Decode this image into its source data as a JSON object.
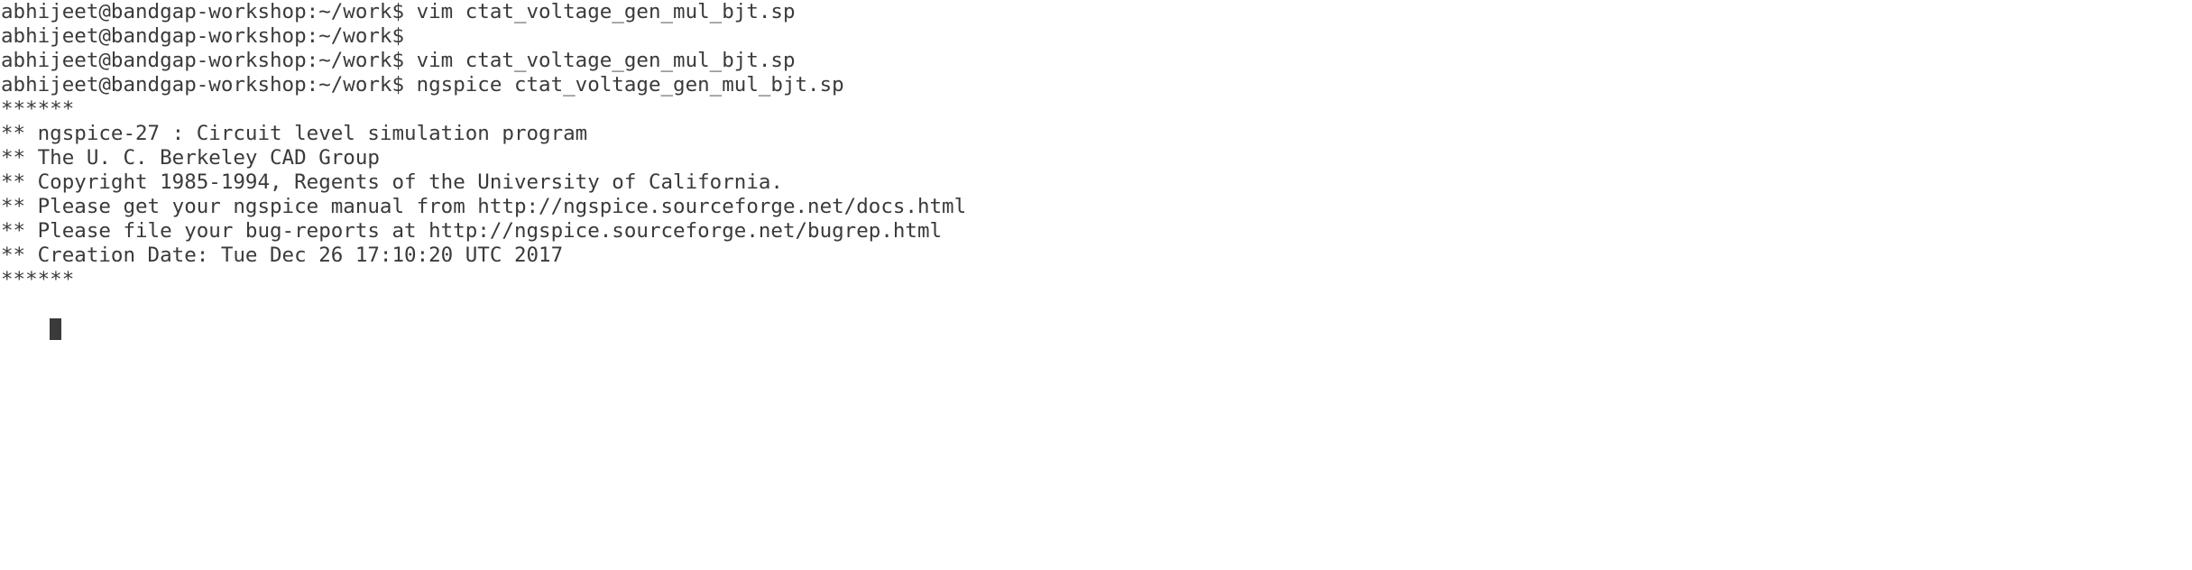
{
  "terminal": {
    "lines": [
      "abhijeet@bandgap-workshop:~/work$ vim ctat_voltage_gen_mul_bjt.sp",
      "abhijeet@bandgap-workshop:~/work$",
      "abhijeet@bandgap-workshop:~/work$ vim ctat_voltage_gen_mul_bjt.sp",
      "abhijeet@bandgap-workshop:~/work$ ngspice ctat_voltage_gen_mul_bjt.sp",
      "******",
      "** ngspice-27 : Circuit level simulation program",
      "** The U. C. Berkeley CAD Group",
      "** Copyright 1985-1994, Regents of the University of California.",
      "** Please get your ngspice manual from http://ngspice.sourceforge.net/docs.html",
      "** Please file your bug-reports at http://ngspice.sourceforge.net/bugrep.html",
      "** Creation Date: Tue Dec 26 17:10:20 UTC 2017",
      "******"
    ],
    "colors": {
      "background": "#ffffff",
      "foreground": "#3a3a3a",
      "cursor": "#3a3a3a"
    }
  }
}
